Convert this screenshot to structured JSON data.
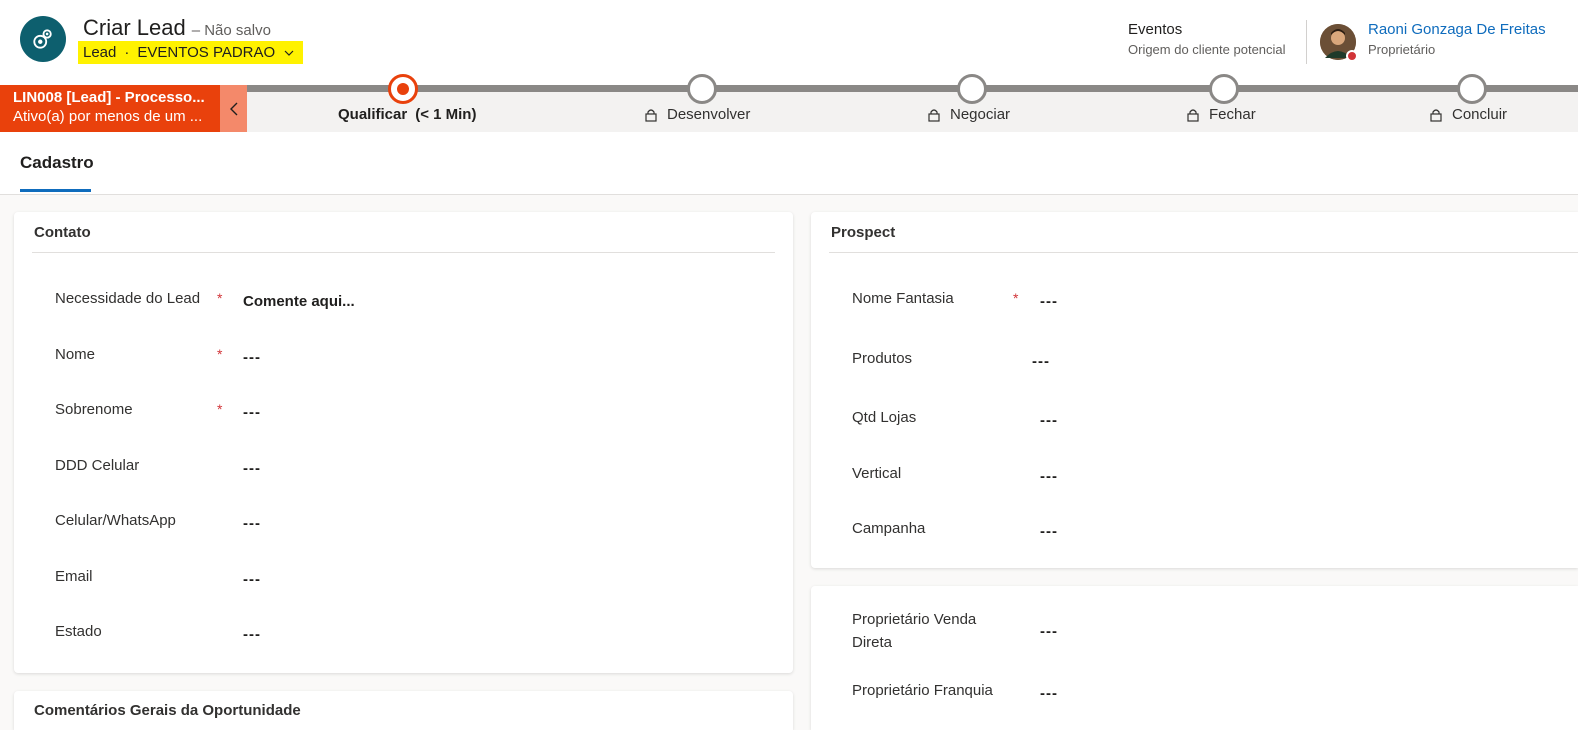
{
  "header": {
    "title": "Criar Lead",
    "status": "– Não salvo",
    "entity": "Lead",
    "separator": "·",
    "form_name": "EVENTOS PADRAO",
    "source_value": "Eventos",
    "source_label": "Origem do cliente potencial",
    "owner_name": "Raoni Gonzaga De Freitas",
    "owner_label": "Proprietário"
  },
  "bpf": {
    "process_name": "LIN008 [Lead] - Processo...",
    "process_status": "Ativo(a) por menos de um ...",
    "stages": [
      {
        "label": "Qualificar",
        "duration": "(< 1 Min)",
        "active": true
      },
      {
        "label": "Desenvolver",
        "locked": true
      },
      {
        "label": "Negociar",
        "locked": true
      },
      {
        "label": "Fechar",
        "locked": true
      },
      {
        "label": "Concluir",
        "locked": true
      }
    ]
  },
  "tabs": [
    {
      "label": "Cadastro",
      "selected": true
    }
  ],
  "contato": {
    "title": "Contato",
    "fields": [
      {
        "label": "Necessidade do Lead",
        "required": "*",
        "value": "Comente aqui..."
      },
      {
        "label": "Nome",
        "required": "*",
        "value": "---"
      },
      {
        "label": "Sobrenome",
        "required": "*",
        "value": "---"
      },
      {
        "label": "DDD Celular",
        "value": "---"
      },
      {
        "label": "Celular/WhatsApp",
        "value": "---"
      },
      {
        "label": "Email",
        "value": "---"
      },
      {
        "label": "Estado",
        "value": "---"
      }
    ]
  },
  "prospect": {
    "title": "Prospect",
    "fields": [
      {
        "label": "Nome Fantasia",
        "required": "*",
        "value": "---"
      },
      {
        "label": "Produtos",
        "value": "---"
      },
      {
        "label": "Qtd Lojas",
        "value": "---"
      },
      {
        "label": "Vertical",
        "value": "---"
      },
      {
        "label": "Campanha",
        "value": "---"
      }
    ]
  },
  "owners": {
    "fields": [
      {
        "label_line1": "Proprietário Venda",
        "label_line2": "Direta",
        "value": "---"
      },
      {
        "label": "Proprietário Franquia",
        "value": "---"
      }
    ]
  },
  "comments": {
    "title": "Comentários Gerais da Oportunidade"
  },
  "colors": {
    "accent": "#e9410c",
    "accent_light": "#f4896a",
    "highlight": "#fff200",
    "link": "#0f6cbd",
    "entity_icon": "#0d5f6e",
    "required": "#d13438"
  },
  "icons": {
    "entity": "lead-gear-icon",
    "form_selector": "chevron-down-icon",
    "collapse": "chevron-left-icon",
    "stage_lock": "lock-icon"
  }
}
